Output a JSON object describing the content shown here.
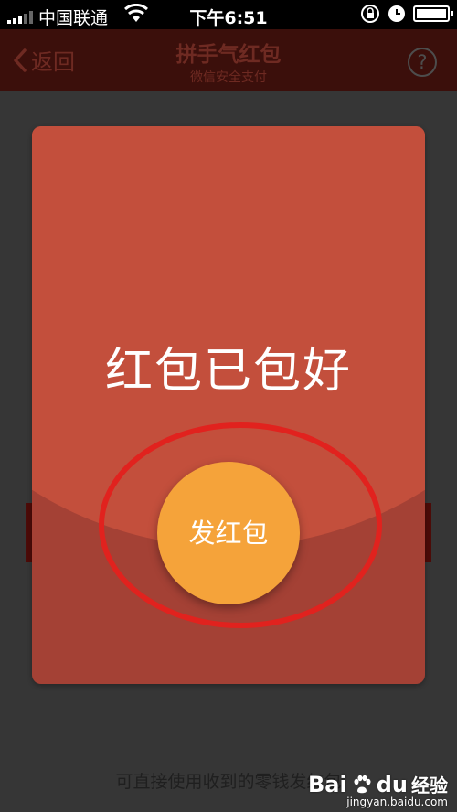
{
  "status_bar": {
    "carrier": "中国联通",
    "time": "下午6:51",
    "icons": [
      "signal-icon",
      "wifi-icon",
      "rotation-lock-icon",
      "alarm-clock-icon",
      "battery-charging-icon"
    ]
  },
  "nav": {
    "back_label": "返回",
    "title": "拼手气红包",
    "subtitle": "微信安全支付",
    "help_label": "?"
  },
  "envelope": {
    "message": "红包已包好",
    "send_label": "发红包"
  },
  "footer": {
    "hint": "可直接使用收到的零钱发红包"
  },
  "watermark": {
    "brand": "Bai",
    "brand_suffix": "du",
    "brand_cn": "经验",
    "domain": "jingyan.baidu.com"
  },
  "colors": {
    "envelope_top": "#c34f3c",
    "envelope_bottom": "#a44135",
    "send_button": "#f5a33a",
    "highlight_ring": "#e1221e",
    "background": "#363636",
    "nav_background": "#3b0f0b"
  }
}
